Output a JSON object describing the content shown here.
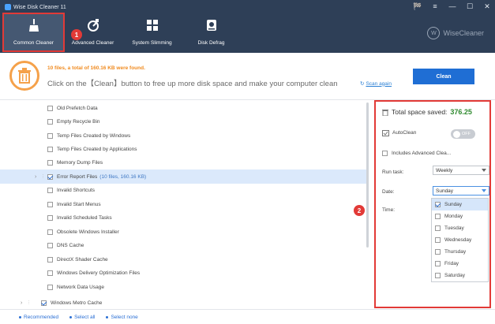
{
  "app": {
    "title": "Wise Disk Cleaner 11"
  },
  "window_controls": [
    "🏁",
    "≡",
    "—",
    "☐",
    "✕"
  ],
  "nav": [
    {
      "label": "Common Cleaner",
      "icon": "broom-icon",
      "active": true
    },
    {
      "label": "Advanced Cleaner",
      "icon": "advanced-cleaner-icon",
      "active": false
    },
    {
      "label": "System Slimming",
      "icon": "windows-icon",
      "active": false
    },
    {
      "label": "Disk Defrag",
      "icon": "disk-icon",
      "active": false
    }
  ],
  "brand": {
    "logo_letter": "W",
    "name": "WiseCleaner"
  },
  "badges": {
    "one": "1",
    "two": "2"
  },
  "banner": {
    "found_text": "10 files, a total of 160.16 KB were found.",
    "hint_text": "Click on the【Clean】button to free up more disk space and make your computer clean",
    "scan_again": "Scan again",
    "clean_button": "Clean"
  },
  "list": [
    {
      "label": "Old Prefetch Data",
      "checked": false
    },
    {
      "label": "Empty Recycle Bin",
      "checked": false
    },
    {
      "label": "Temp Files Created by Windows",
      "checked": false
    },
    {
      "label": "Temp Files Created by Applications",
      "checked": false
    },
    {
      "label": "Memory Dump Files",
      "checked": false
    },
    {
      "label": "Error Report Files",
      "sub": "(10 files, 160.16 KB)",
      "checked": true,
      "highlight": true
    },
    {
      "label": "Invalid Shortcuts",
      "checked": false
    },
    {
      "label": "Invalid Start Menus",
      "checked": false
    },
    {
      "label": "Invalid Scheduled Tasks",
      "checked": false
    },
    {
      "label": "Obsolete Windows Installer",
      "checked": false
    },
    {
      "label": "DNS Cache",
      "checked": false
    },
    {
      "label": "DirectX Shader Cache",
      "checked": false
    },
    {
      "label": "Windows Delivery Optimization Files",
      "checked": false
    },
    {
      "label": "Network Data Usage",
      "checked": false
    },
    {
      "label": "Windows Metro Cache",
      "checked": true,
      "group": true
    }
  ],
  "bottom": {
    "recommended": "Recommended",
    "select_all": "Select all",
    "select_none": "Select none"
  },
  "panel": {
    "saved_label": "Total space saved:",
    "saved_value": "376.25",
    "autoclean": "AutoClean",
    "toggle": "OFF",
    "includes_advanced": "Includes Advanced Clea...",
    "run_task_label": "Run task:",
    "run_task_value": "Weekly",
    "date_label": "Date:",
    "date_value": "Sunday",
    "time_label": "Time:",
    "days": [
      {
        "label": "Sunday",
        "checked": true
      },
      {
        "label": "Monday",
        "checked": false
      },
      {
        "label": "Tuesday",
        "checked": false
      },
      {
        "label": "Wednesday",
        "checked": false
      },
      {
        "label": "Thursday",
        "checked": false
      },
      {
        "label": "Friday",
        "checked": false
      },
      {
        "label": "Saturday",
        "checked": false
      }
    ]
  },
  "colors": {
    "titlebar": "#2e3f57",
    "accent": "#1f6ed4",
    "highlight": "#e23a37",
    "orange": "#f08a1e",
    "green": "#2f8a2f"
  }
}
